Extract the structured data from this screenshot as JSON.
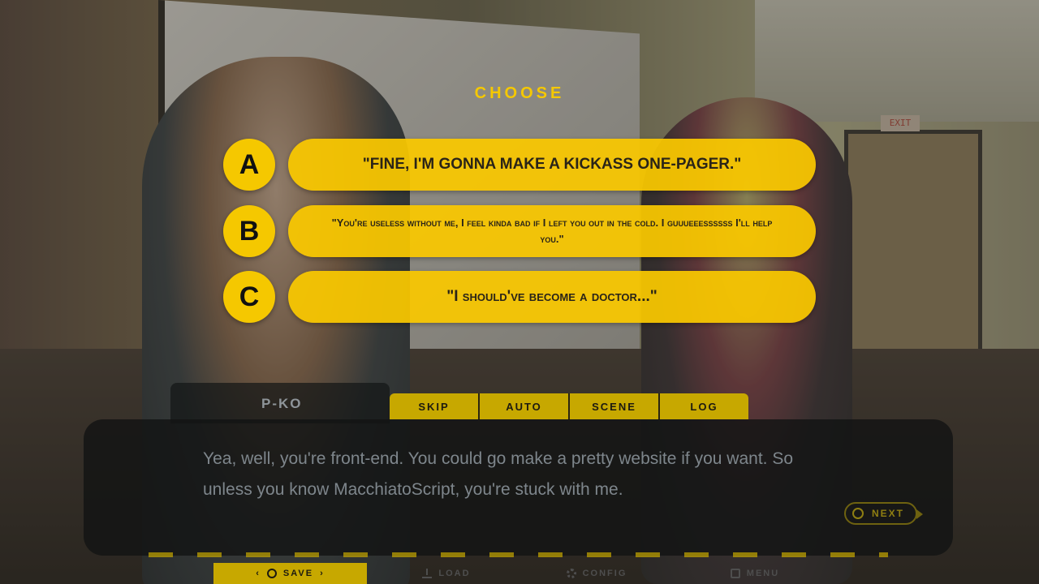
{
  "choice_menu": {
    "title": "CHOOSE",
    "options": [
      {
        "letter": "A",
        "text": "\"FINE, I'M GONNA MAKE A KICKASS ONE-PAGER.\""
      },
      {
        "letter": "B",
        "text": "\"You're useless without me, I feel kinda bad if I left you out in the cold. I guuueeessssss I'll help you.\""
      },
      {
        "letter": "C",
        "text": "\"I should've become a doctor...\""
      }
    ]
  },
  "dialogue": {
    "speaker": "P-KO",
    "line": "Yea, well, you're front-end. You could go make a pretty website if you want. So unless you know MacchiatoScript, you're stuck with me.",
    "next_label": "NEXT"
  },
  "quick_menu": {
    "skip": "SKIP",
    "auto": "AUTO",
    "scene": "SCENE",
    "log": "LOG"
  },
  "system_menu": {
    "save": "SAVE",
    "load": "LOAD",
    "config": "CONFIG",
    "menu": "MENU"
  },
  "scene": {
    "exit_sign": "EXIT"
  },
  "colors": {
    "accent": "#f5c800",
    "dialog_bg": "#141616",
    "dialog_text": "#7e868c"
  }
}
